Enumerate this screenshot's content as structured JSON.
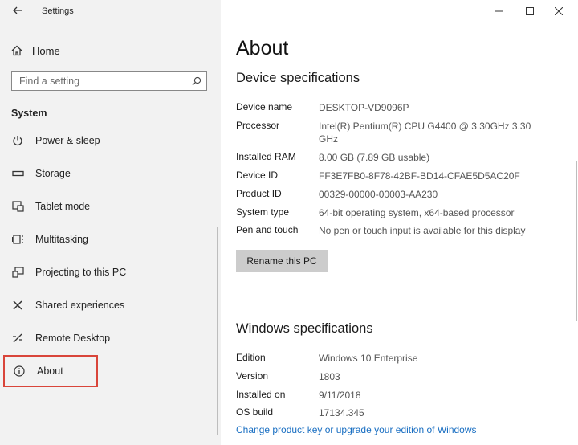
{
  "window": {
    "title": "Settings",
    "controls": [
      "minimize",
      "maximize",
      "close"
    ]
  },
  "sidebar": {
    "home_label": "Home",
    "search_placeholder": "Find a setting",
    "section_title": "System",
    "items": [
      {
        "label": "Power & sleep",
        "icon": "power-icon"
      },
      {
        "label": "Storage",
        "icon": "storage-icon"
      },
      {
        "label": "Tablet mode",
        "icon": "tablet-mode-icon"
      },
      {
        "label": "Multitasking",
        "icon": "multitasking-icon"
      },
      {
        "label": "Projecting to this PC",
        "icon": "projecting-icon"
      },
      {
        "label": "Shared experiences",
        "icon": "shared-experiences-icon"
      },
      {
        "label": "Remote Desktop",
        "icon": "remote-desktop-icon"
      },
      {
        "label": "About",
        "icon": "info-icon",
        "active": true
      }
    ],
    "highlight_color": "#d9453a"
  },
  "main": {
    "title": "About",
    "device_heading": "Device specifications",
    "device_specs": [
      {
        "key": "Device name",
        "value": "DESKTOP-VD9096P"
      },
      {
        "key": "Processor",
        "value": "Intel(R) Pentium(R) CPU G4400 @ 3.30GHz   3.30 GHz"
      },
      {
        "key": "Installed RAM",
        "value": "8.00 GB (7.89 GB usable)"
      },
      {
        "key": "Device ID",
        "value": "FF3E7FB0-8F78-42BF-BD14-CFAE5D5AC20F"
      },
      {
        "key": "Product ID",
        "value": "00329-00000-00003-AA230"
      },
      {
        "key": "System type",
        "value": "64-bit operating system, x64-based processor"
      },
      {
        "key": "Pen and touch",
        "value": "No pen or touch input is available for this display"
      }
    ],
    "rename_label": "Rename this PC",
    "windows_heading": "Windows specifications",
    "windows_specs": [
      {
        "key": "Edition",
        "value": "Windows 10 Enterprise"
      },
      {
        "key": "Version",
        "value": "1803"
      },
      {
        "key": "Installed on",
        "value": "9/11/2018"
      },
      {
        "key": "OS build",
        "value": "17134.345"
      }
    ],
    "product_key_link": "Change product key or upgrade your edition of Windows",
    "link_color": "#1a6fc2"
  }
}
